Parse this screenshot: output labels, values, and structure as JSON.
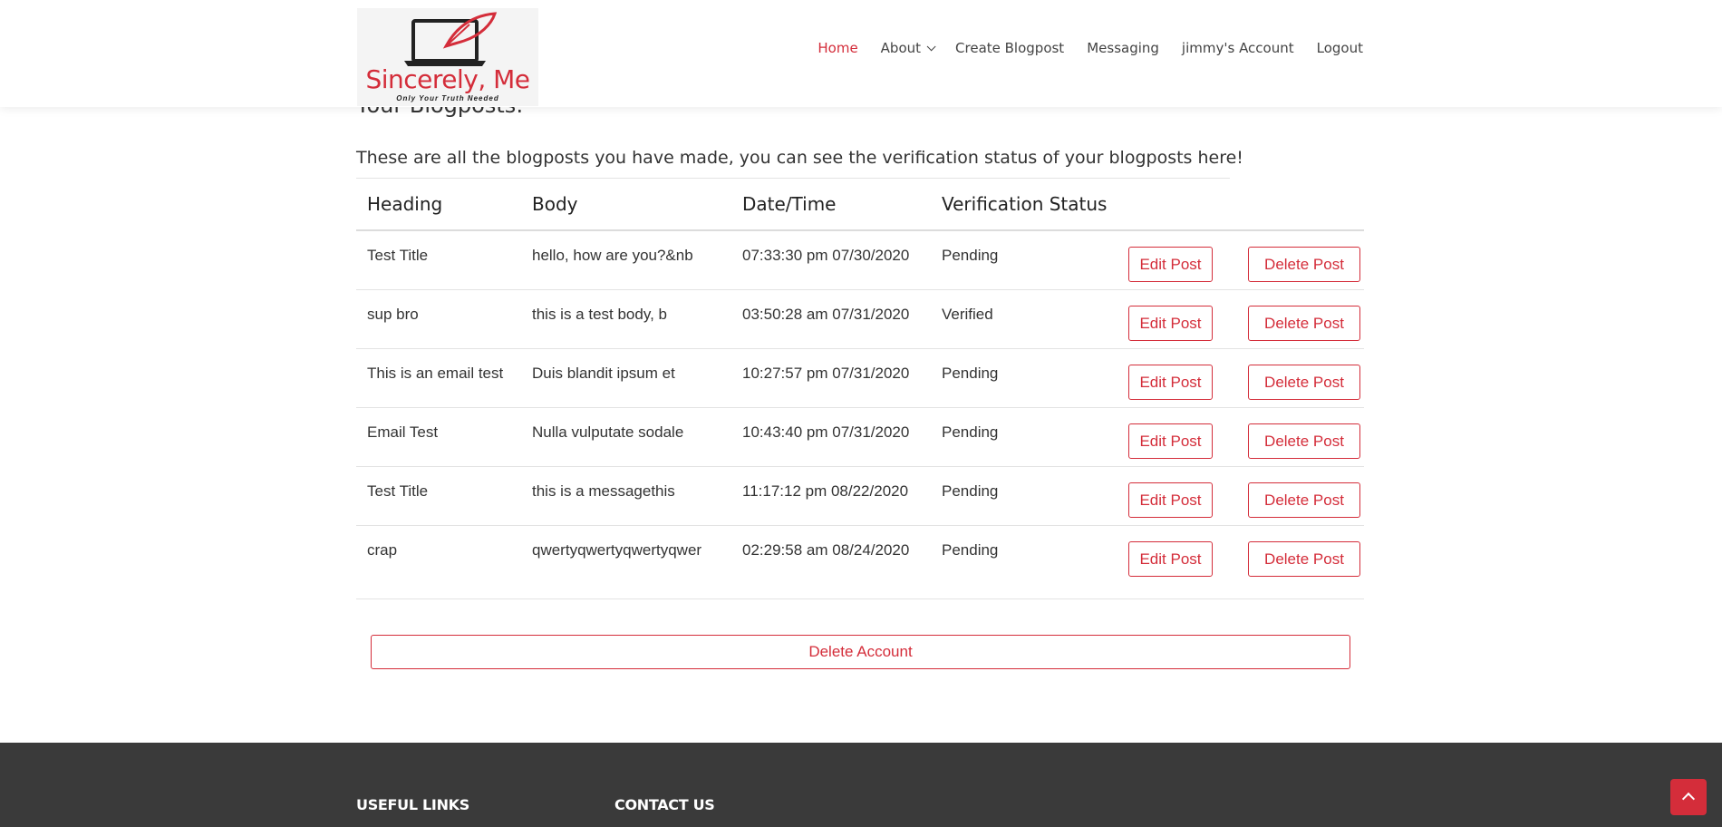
{
  "brand": {
    "name": "Sincerely, Me",
    "tagline": "Only Your Truth Needed",
    "accent_color": "#d42d3a"
  },
  "nav": {
    "items": [
      {
        "label": "Home",
        "active": true
      },
      {
        "label": "About",
        "dropdown": true
      },
      {
        "label": "Create Blogpost"
      },
      {
        "label": "Messaging"
      },
      {
        "label": "jimmy's Account"
      },
      {
        "label": "Logout"
      }
    ]
  },
  "page": {
    "title": "Your Blogposts:",
    "intro": "These are all the blogposts you have made, you can see the verification status of your blogposts here!"
  },
  "table": {
    "columns": [
      "Heading",
      "Body",
      "Date/Time",
      "Verification Status"
    ],
    "rows": [
      {
        "heading": "Test Title",
        "body": "hello, how are you?&nb",
        "datetime": "07:33:30 pm 07/30/2020",
        "status": "Pending"
      },
      {
        "heading": "sup bro",
        "body": "this is a test body, b",
        "datetime": "03:50:28 am 07/31/2020",
        "status": "Verified"
      },
      {
        "heading": "This is an email test",
        "body": "Duis blandit ipsum et",
        "datetime": "10:27:57 pm 07/31/2020",
        "status": "Pending"
      },
      {
        "heading": "Email Test",
        "body": "Nulla vulputate sodale",
        "datetime": "10:43:40 pm 07/31/2020",
        "status": "Pending"
      },
      {
        "heading": "Test Title",
        "body": "this is a messagethis",
        "datetime": "11:17:12 pm 08/22/2020",
        "status": "Pending"
      },
      {
        "heading": "crap",
        "body": "qwertyqwertyqwertyqwer",
        "datetime": "02:29:58 am 08/24/2020",
        "status": "Pending"
      }
    ],
    "edit_label": "Edit Post",
    "delete_label": "Delete Post"
  },
  "delete_account_label": "Delete Account",
  "footer": {
    "useful_links": "USEFUL LINKS",
    "contact_us": "CONTACT US"
  }
}
